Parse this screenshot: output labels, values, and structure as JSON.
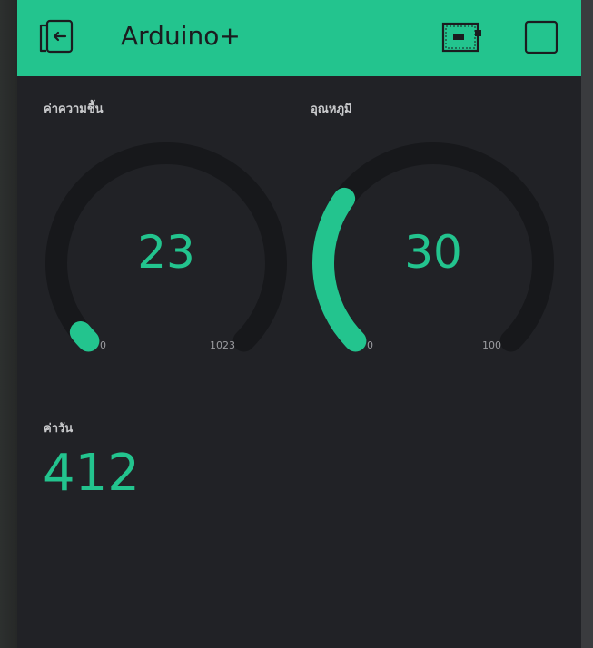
{
  "header": {
    "title": "Arduino+",
    "background": "#23c48e",
    "icons": [
      "back-exit-icon",
      "device-board-icon",
      "stop-square-icon"
    ]
  },
  "widgets": {
    "gauge1": {
      "label": "ค่าความชื้น",
      "value": "23",
      "min": "0",
      "max": "1023",
      "fraction": 0.0225
    },
    "gauge2": {
      "label": "อุณหภูมิ",
      "value": "30",
      "min": "0",
      "max": "100",
      "fraction": 0.3
    },
    "value_display": {
      "label": "ค่าวัน",
      "value": "412"
    }
  },
  "colors": {
    "accent": "#23c48e",
    "background": "#212226",
    "track": "#17181b",
    "text_muted": "#c9cacc"
  }
}
